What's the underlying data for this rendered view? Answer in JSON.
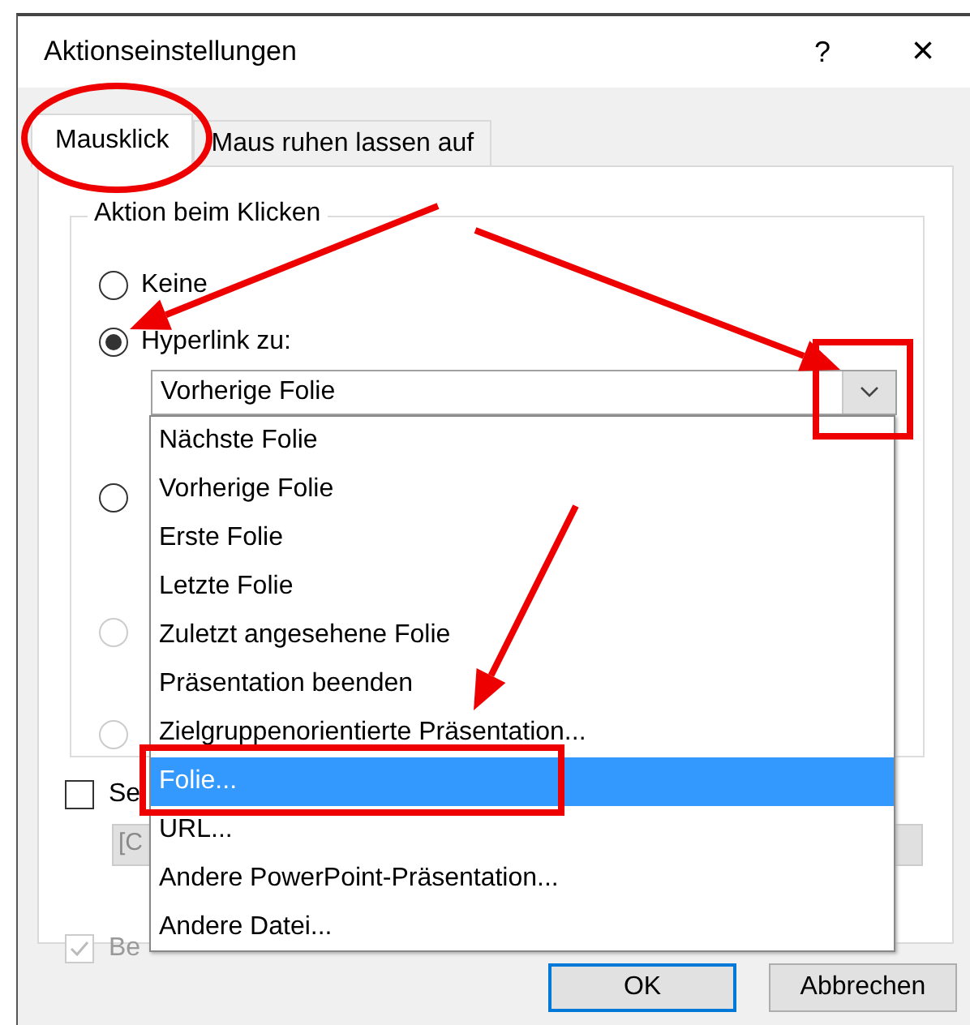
{
  "window": {
    "title": "Aktionseinstellungen",
    "help": "?",
    "close": "×"
  },
  "tabs": [
    {
      "label": "Mausklick",
      "selected": true
    },
    {
      "label": "Maus ruhen lassen auf",
      "selected": false
    }
  ],
  "group": {
    "title": "Aktion beim Klicken",
    "options": [
      {
        "label": "Keine",
        "selected": false,
        "disabled": false
      },
      {
        "label": "Hyperlink zu:",
        "selected": true,
        "disabled": false
      },
      {
        "selected": false,
        "disabled": false
      },
      {
        "selected": false,
        "disabled": true
      },
      {
        "selected": false,
        "disabled": true
      }
    ],
    "hyperlink_value": "Vorherige Folie",
    "dropdown_items": [
      {
        "label": "Nächste Folie",
        "selected": false
      },
      {
        "label": "Vorherige Folie",
        "selected": false
      },
      {
        "label": "Erste Folie",
        "selected": false
      },
      {
        "label": "Letzte Folie",
        "selected": false
      },
      {
        "label": "Zuletzt angesehene Folie",
        "selected": false
      },
      {
        "label": "Präsentation beenden",
        "selected": false
      },
      {
        "label": "Zielgruppenorientierte Präsentation...",
        "selected": false
      },
      {
        "label": "Folie...",
        "selected": true
      },
      {
        "label": "URL...",
        "selected": false
      },
      {
        "label": "Andere PowerPoint-Präsentation...",
        "selected": false
      },
      {
        "label": "Andere Datei...",
        "selected": false
      }
    ]
  },
  "sound": {
    "label": "Se",
    "checked": false,
    "value": "[C"
  },
  "highlight": {
    "label": "Be",
    "checked": true,
    "disabled": true
  },
  "buttons": [
    {
      "label": "OK",
      "default": true
    },
    {
      "label": "Abbrechen",
      "default": false
    }
  ]
}
